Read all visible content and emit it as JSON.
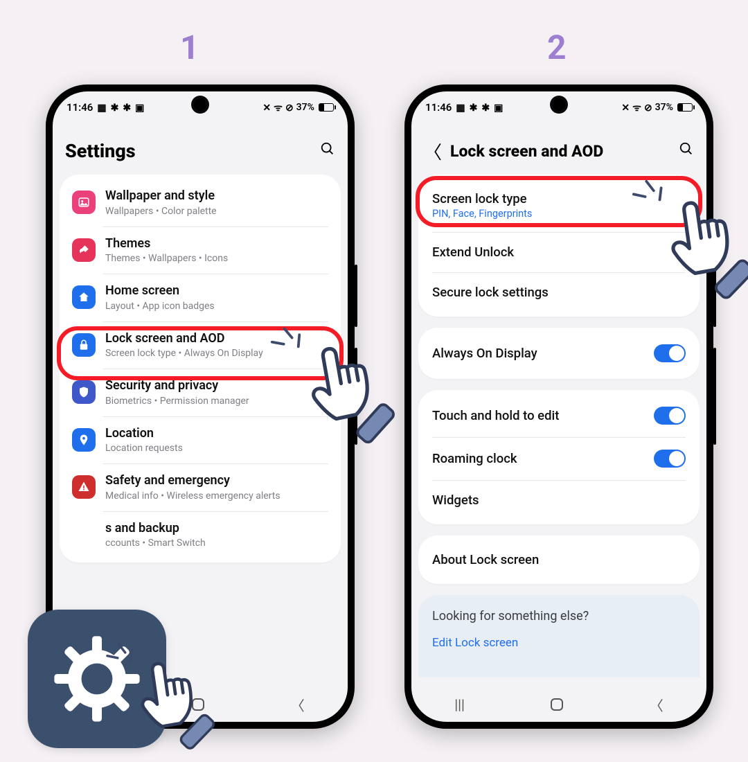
{
  "steps": {
    "s1": "1",
    "s2": "2"
  },
  "status": {
    "time": "11:46",
    "battery": "37%"
  },
  "phone1": {
    "title": "Settings",
    "rows": [
      {
        "icon_color": "#ec407a",
        "glyph": "image",
        "title": "Wallpaper and style",
        "sub": "Wallpapers  •  Color palette"
      },
      {
        "icon_color": "#e6335a",
        "glyph": "brush",
        "title": "Themes",
        "sub": "Themes  •  Wallpapers  •  Icons"
      },
      {
        "icon_color": "#1f6fed",
        "glyph": "home",
        "title": "Home screen",
        "sub": "Layout  •  App icon badges"
      },
      {
        "icon_color": "#1f6fed",
        "glyph": "lock",
        "title": "Lock screen and AOD",
        "sub": "Screen lock type  •  Always On Display"
      },
      {
        "icon_color": "#3e57c9",
        "glyph": "shield",
        "title": "Security and privacy",
        "sub": "Biometrics  •  Permission manager"
      },
      {
        "icon_color": "#1f6fed",
        "glyph": "pin",
        "title": "Location",
        "sub": "Location requests"
      },
      {
        "icon_color": "#cf2e2e",
        "glyph": "alert",
        "title": "Safety and emergency",
        "sub": "Medical info  •  Wireless emergency alerts"
      },
      {
        "icon_color": "",
        "glyph": "",
        "title": "s and backup",
        "sub": "ccounts  •  Smart Switch"
      }
    ]
  },
  "phone2": {
    "title": "Lock screen and AOD",
    "group1": [
      {
        "title": "Screen lock type",
        "sub": "PIN, Face, Fingerprints"
      },
      {
        "title": "Extend Unlock"
      },
      {
        "title": "Secure lock settings"
      }
    ],
    "group2": [
      {
        "title": "Always On Display",
        "toggle": true
      }
    ],
    "group3": [
      {
        "title": "Touch and hold to edit",
        "toggle": true
      },
      {
        "title": "Roaming clock",
        "toggle": true
      },
      {
        "title": "Widgets"
      }
    ],
    "group4": [
      {
        "title": "About Lock screen"
      }
    ],
    "footer": {
      "question": "Looking for something else?",
      "link": "Edit Lock screen"
    }
  }
}
